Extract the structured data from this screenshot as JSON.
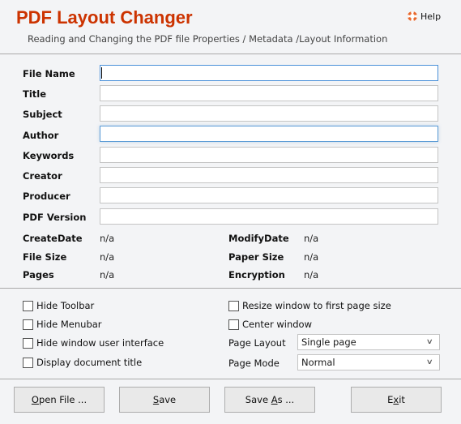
{
  "header": {
    "title": "PDF Layout Changer",
    "subtitle": "Reading and Changing the PDF file Properties / Metadata /Layout Information",
    "help_label": "Help",
    "help_icon": "lifebuoy-icon",
    "accent_color": "#cc3300"
  },
  "fields": [
    {
      "label": "File Name",
      "value": "",
      "state": "focused"
    },
    {
      "label": "Title",
      "value": ""
    },
    {
      "label": "Subject",
      "value": ""
    },
    {
      "label": "Author",
      "value": "",
      "state": "hovered"
    },
    {
      "label": "Keywords",
      "value": ""
    },
    {
      "label": "Creator",
      "value": ""
    },
    {
      "label": "Producer",
      "value": ""
    },
    {
      "label": "PDF Version",
      "value": ""
    }
  ],
  "info": {
    "create_date": {
      "label": "CreateDate",
      "value": "n/a"
    },
    "modify_date": {
      "label": "ModifyDate",
      "value": "n/a"
    },
    "file_size": {
      "label": "File Size",
      "value": "n/a"
    },
    "paper_size": {
      "label": "Paper Size",
      "value": "n/a"
    },
    "pages": {
      "label": "Pages",
      "value": "n/a"
    },
    "encryption": {
      "label": "Encryption",
      "value": "n/a"
    }
  },
  "options": {
    "hide_toolbar": {
      "label": "Hide Toolbar",
      "checked": false
    },
    "hide_menubar": {
      "label": "Hide Menubar",
      "checked": false
    },
    "hide_window_ui": {
      "label": "Hide window user interface",
      "checked": false
    },
    "display_doc_title": {
      "label": "Display document title",
      "checked": false
    },
    "resize_window": {
      "label": "Resize window to first page size",
      "checked": false
    },
    "center_window": {
      "label": "Center window",
      "checked": false
    },
    "page_layout": {
      "label": "Page Layout",
      "value": "Single page"
    },
    "page_mode": {
      "label": "Page Mode",
      "value": "Normal"
    }
  },
  "buttons": {
    "open": {
      "mnemonic": "O",
      "rest": "pen File ..."
    },
    "save": {
      "mnemonic": "S",
      "rest": "ave"
    },
    "save_as": {
      "pre": "Save ",
      "mnemonic": "A",
      "rest": "s ..."
    },
    "exit": {
      "pre": "E",
      "mnemonic": "x",
      "rest": "it"
    }
  }
}
